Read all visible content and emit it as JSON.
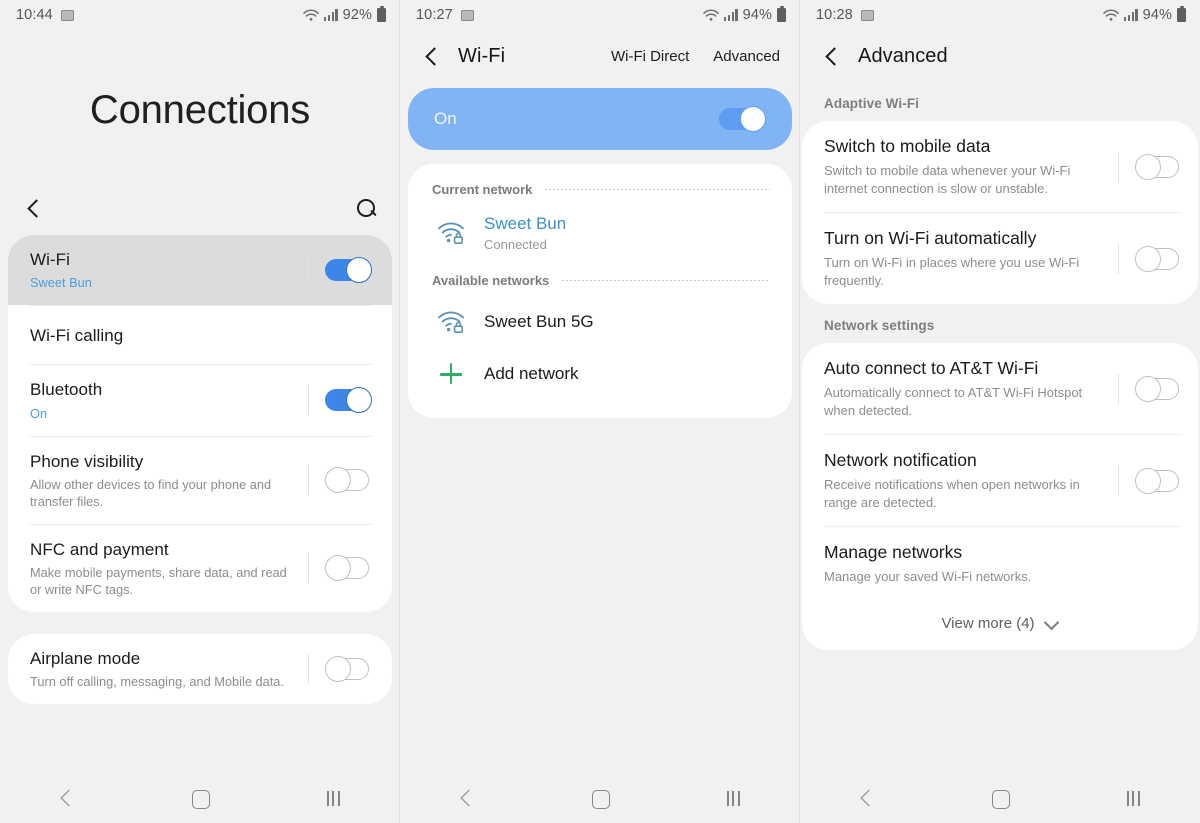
{
  "panels": [
    {
      "status": {
        "time": "10:44",
        "battery": "92%",
        "image_icon": "image-icon",
        "wifi_icon": "wifi-icon",
        "signal_icon": "signal-icon",
        "battery_icon": "battery-icon"
      },
      "title": "Connections",
      "back_icon": "back-chevron-icon",
      "search_icon": "search-icon",
      "cards": [
        {
          "rows": [
            {
              "title": "Wi-Fi",
              "sub": "Sweet Bun",
              "sub_accent": true,
              "toggle": "on",
              "selected": true
            },
            {
              "title": "Wi-Fi calling",
              "sub": "",
              "toggle": "none",
              "selected": false
            },
            {
              "title": "Bluetooth",
              "sub": "On",
              "sub_accent": true,
              "toggle": "on",
              "selected": false
            },
            {
              "title": "Phone visibility",
              "sub": "Allow other devices to find your phone and transfer files.",
              "toggle": "off",
              "selected": false
            },
            {
              "title": "NFC and payment",
              "sub": "Make mobile payments, share data, and read or write NFC tags.",
              "toggle": "off",
              "selected": false
            }
          ]
        },
        {
          "rows": [
            {
              "title": "Airplane mode",
              "sub": "Turn off calling, messaging, and Mobile data.",
              "toggle": "off",
              "selected": false
            }
          ]
        }
      ],
      "nav": {
        "back": "nav-back-icon",
        "home": "nav-home-icon",
        "recents": "nav-recents-icon"
      }
    },
    {
      "status": {
        "time": "10:27",
        "battery": "94%",
        "image_icon": "image-icon",
        "wifi_icon": "wifi-icon",
        "signal_icon": "signal-icon",
        "battery_icon": "battery-icon"
      },
      "title": "Wi-Fi",
      "back_icon": "back-chevron-icon",
      "actions": [
        {
          "label": "Wi-Fi Direct",
          "pressed": false
        },
        {
          "label": "Advanced",
          "pressed": true
        }
      ],
      "master": {
        "label": "On",
        "toggle": "on"
      },
      "sections": [
        {
          "label": "Current network",
          "items": [
            {
              "name": "Sweet Bun",
              "sub": "Connected",
              "icon": "wifi-lock-icon",
              "connected": true
            }
          ]
        },
        {
          "label": "Available networks",
          "items": [
            {
              "name": "Sweet Bun 5G",
              "sub": "",
              "icon": "wifi-lock-icon",
              "connected": false
            },
            {
              "name": "Add network",
              "sub": "",
              "icon": "plus-icon",
              "connected": false
            }
          ]
        }
      ],
      "nav": {
        "back": "nav-back-icon",
        "home": "nav-home-icon",
        "recents": "nav-recents-icon"
      }
    },
    {
      "status": {
        "time": "10:28",
        "battery": "94%",
        "image_icon": "image-icon",
        "wifi_icon": "wifi-icon",
        "signal_icon": "signal-icon",
        "battery_icon": "battery-icon"
      },
      "title": "Advanced",
      "back_icon": "back-chevron-icon",
      "groups": [
        {
          "label": "Adaptive Wi-Fi",
          "rows": [
            {
              "title": "Switch to mobile data",
              "sub": "Switch to mobile data whenever your Wi-Fi internet connection is slow or unstable.",
              "toggle": "off"
            },
            {
              "title": "Turn on Wi-Fi automatically",
              "sub": "Turn on Wi-Fi in places where you use Wi-Fi frequently.",
              "toggle": "off"
            }
          ]
        },
        {
          "label": "Network settings",
          "rows": [
            {
              "title": "Auto connect to AT&T Wi-Fi",
              "sub": "Automatically connect to AT&T Wi-Fi Hotspot when detected.",
              "toggle": "off"
            },
            {
              "title": "Network notification",
              "sub": "Receive notifications when open networks in range are detected.",
              "toggle": "off"
            },
            {
              "title": "Manage networks",
              "sub": "Manage your saved Wi-Fi networks.",
              "toggle": "none"
            }
          ],
          "view_more": {
            "label": "View more (4)",
            "icon": "chevron-down-icon"
          }
        }
      ],
      "nav": {
        "back": "nav-back-icon",
        "home": "nav-home-icon",
        "recents": "nav-recents-icon"
      }
    }
  ],
  "colors": {
    "accent_blue": "#3d86e8",
    "link_blue": "#4a9fe0",
    "master_bar": "#80b4f4",
    "wifi_icon": "#5b93b5",
    "plus_green": "#2eaf68",
    "page_bg": "#f1f1f1",
    "card_bg": "#ffffff",
    "selected_row": "#dcdcdc"
  }
}
